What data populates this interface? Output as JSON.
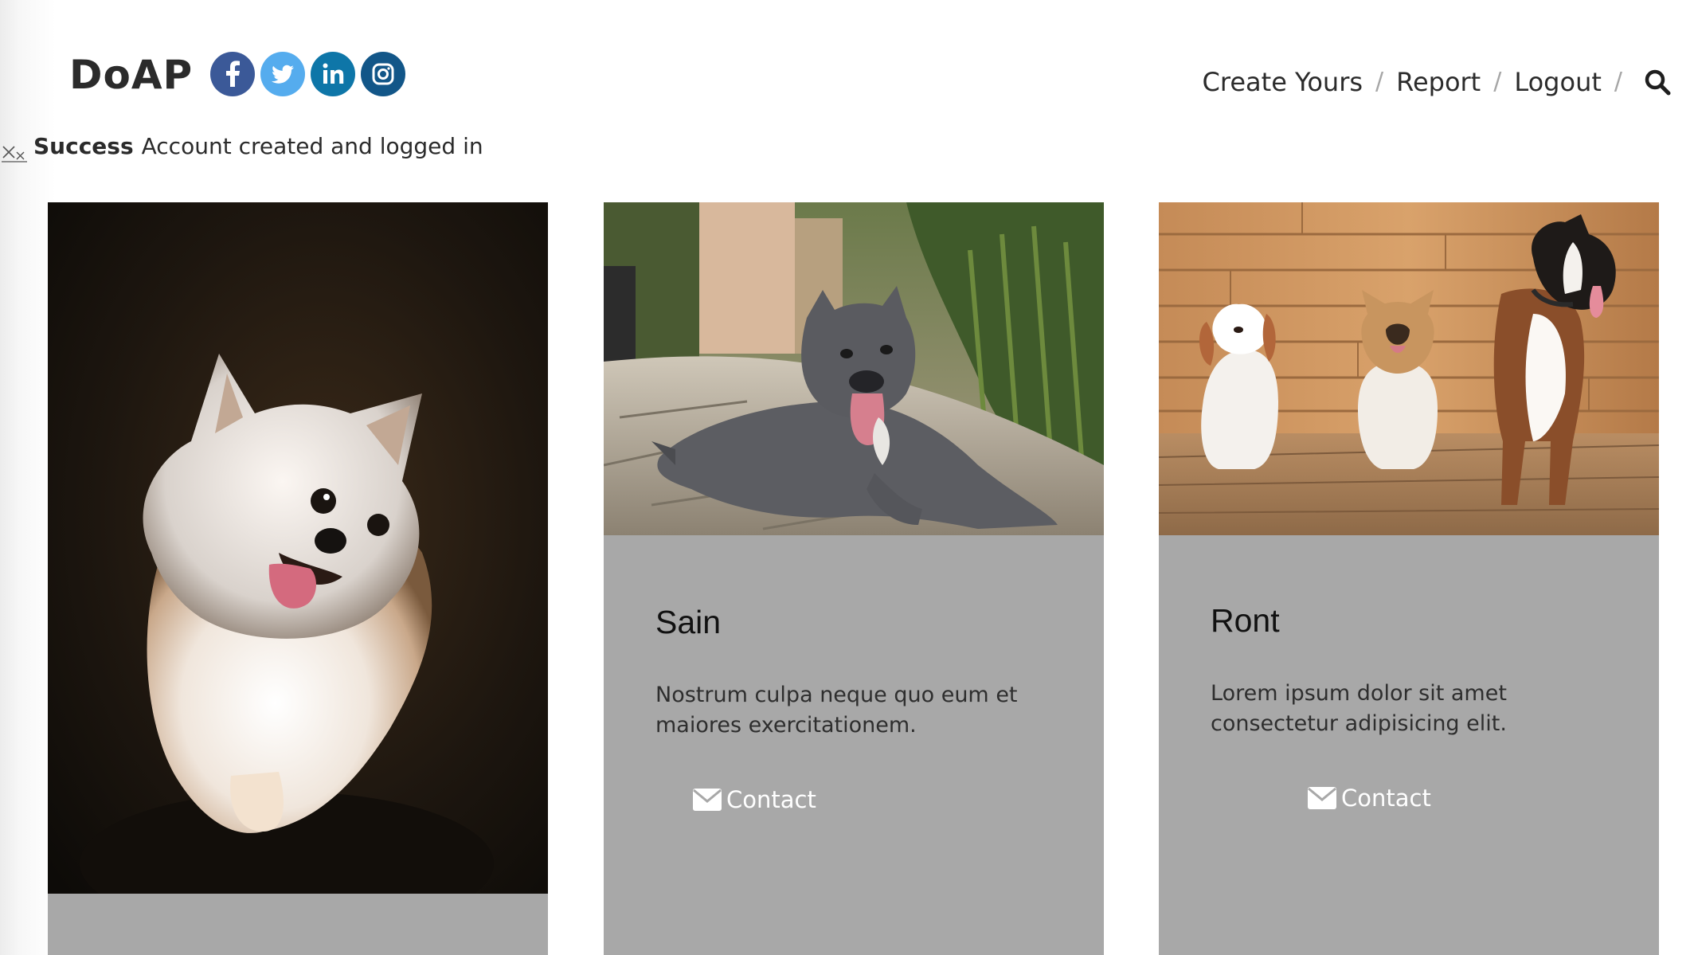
{
  "header": {
    "brand": "DoAP",
    "social": [
      {
        "name": "facebook",
        "icon": "facebook-icon",
        "color": "#3b5998"
      },
      {
        "name": "twitter",
        "icon": "twitter-icon",
        "color": "#55acee"
      },
      {
        "name": "linkedin",
        "icon": "linkedin-icon",
        "color": "#0e76a8"
      },
      {
        "name": "instagram",
        "icon": "instagram-icon",
        "color": "#125688"
      }
    ],
    "nav": {
      "create_yours": "Create Yours",
      "report": "Report",
      "logout": "Logout",
      "separator": "/",
      "search_icon": "search-icon"
    }
  },
  "alert": {
    "close_icon": "close-icon",
    "title": "Success",
    "message": "Account created and logged in"
  },
  "cards": [
    {
      "photo": "white spitz dog photo",
      "name": "",
      "text": ""
    },
    {
      "photo": "grey pit bull lying on path photo",
      "name": "Sain",
      "text": "Nostrum culpa neque quo eum et maiores exercitationem.",
      "contact_label": "Contact",
      "contact_icon": "envelope-icon"
    },
    {
      "photo": "three dogs sitting on wooden deck photo",
      "name": "Ront",
      "text": "Lorem ipsum dolor sit amet consectetur adipisicing elit.",
      "contact_label": "Contact",
      "contact_icon": "envelope-icon"
    }
  ],
  "colors": {
    "card_background": "#a8a8a8",
    "text_dark": "#2b2b2b"
  }
}
